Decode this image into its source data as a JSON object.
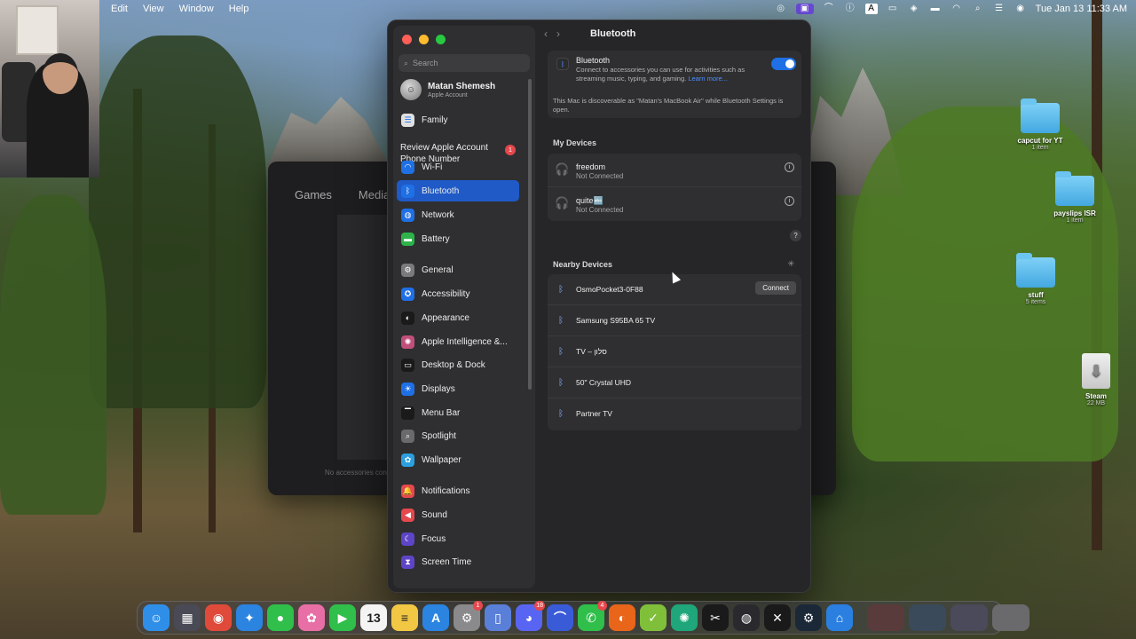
{
  "menubar": {
    "menus": [
      "Edit",
      "View",
      "Window",
      "Help"
    ],
    "datetime": "Tue Jan 13  11:33 AM",
    "status_icons": [
      "control-center-icon",
      "screen-record-icon",
      "bluetooth-status-icon",
      "a11y-icon",
      "input-a-icon",
      "display-icon",
      "vpn-icon",
      "battery-icon",
      "wifi-icon",
      "search-icon",
      "control-switch-icon",
      "siri-icon"
    ]
  },
  "background_window": {
    "tabs": [
      "Games",
      "Media"
    ],
    "footer": "No accessories conn"
  },
  "settings": {
    "search_placeholder": "Search",
    "account": {
      "name": "Matan Shemesh",
      "subtitle": "Apple Account"
    },
    "family": "Family",
    "review": {
      "label": "Review Apple Account Phone Number",
      "badge": "1"
    },
    "sidebar_items": [
      {
        "label": "Wi-Fi",
        "icon": "wifi-icon",
        "color": "#1f6fe5"
      },
      {
        "label": "Bluetooth",
        "icon": "bluetooth-icon",
        "color": "#1f6fe5",
        "selected": true
      },
      {
        "label": "Network",
        "icon": "globe-icon",
        "color": "#1f6fe5"
      },
      {
        "label": "Battery",
        "icon": "battery-icon",
        "color": "#2db34a"
      },
      {
        "label": "General",
        "icon": "gear-icon",
        "color": "#7a7a7c"
      },
      {
        "label": "Accessibility",
        "icon": "accessibility-icon",
        "color": "#1f6fe5"
      },
      {
        "label": "Appearance",
        "icon": "appearance-icon",
        "color": "#1a1a1a"
      },
      {
        "label": "Apple Intelligence &...",
        "icon": "apple-intelligence-icon",
        "color": "#c0507a"
      },
      {
        "label": "Desktop & Dock",
        "icon": "dock-icon",
        "color": "#1a1a1a"
      },
      {
        "label": "Displays",
        "icon": "sun-icon",
        "color": "#1f6fe5"
      },
      {
        "label": "Menu Bar",
        "icon": "menubar-icon",
        "color": "#1a1a1a"
      },
      {
        "label": "Spotlight",
        "icon": "magnifier-icon",
        "color": "#6a6a6c"
      },
      {
        "label": "Wallpaper",
        "icon": "flower-icon",
        "color": "#2b9fe0"
      },
      {
        "label": "Notifications",
        "icon": "bell-icon",
        "color": "#e5484d"
      },
      {
        "label": "Sound",
        "icon": "speaker-icon",
        "color": "#e5484d"
      },
      {
        "label": "Focus",
        "icon": "moon-icon",
        "color": "#5e45c7"
      },
      {
        "label": "Screen Time",
        "icon": "hourglass-icon",
        "color": "#5e45c7"
      }
    ],
    "content": {
      "title": "Bluetooth",
      "bluetooth_label": "Bluetooth",
      "bluetooth_desc": "Connect to accessories you can use for activities such as streaming music, typing, and gaming.",
      "learn_more": "Learn more...",
      "bluetooth_on": true,
      "discoverable": "This Mac is discoverable as \"Matan's MacBook Air\" while Bluetooth Settings is open.",
      "my_devices_title": "My Devices",
      "my_devices": [
        {
          "name": "freedom",
          "status": "Not Connected"
        },
        {
          "name": "quite🔤",
          "status": "Not Connected"
        }
      ],
      "help": "?",
      "nearby_title": "Nearby Devices",
      "nearby": [
        {
          "name": "OsmoPocket3-0F88",
          "action": "Connect"
        },
        {
          "name": "Samsung S95BA 65 TV"
        },
        {
          "name": "TV – סלון"
        },
        {
          "name": "50\" Crystal UHD"
        },
        {
          "name": "Partner TV"
        }
      ]
    }
  },
  "desktop_icons": [
    {
      "name": "capcut for YT",
      "sub": "1 item",
      "type": "folder"
    },
    {
      "name": "payslips ISR",
      "sub": "1 item",
      "type": "folder"
    },
    {
      "name": "stuff",
      "sub": "5 items",
      "type": "folder"
    },
    {
      "name": "Steam",
      "sub": "22 MB",
      "type": "disk"
    }
  ],
  "dock": {
    "apps": [
      {
        "name": "finder-icon",
        "glyph": "☺",
        "color": "#2f8fe8"
      },
      {
        "name": "launchpad-icon",
        "glyph": "▦",
        "color": "#4a4a56"
      },
      {
        "name": "chrome-icon",
        "glyph": "◉",
        "color": "#e04a3a"
      },
      {
        "name": "safari-icon",
        "glyph": "✦",
        "color": "#2a84e0"
      },
      {
        "name": "messages-icon",
        "glyph": "●",
        "color": "#2fbf4a"
      },
      {
        "name": "photos-icon",
        "glyph": "✿",
        "color": "#e86fa6"
      },
      {
        "name": "facetime-icon",
        "glyph": "▶",
        "color": "#2fbf4a"
      },
      {
        "name": "calendar-icon",
        "glyph": "13",
        "color": "#f4f4f4"
      },
      {
        "name": "notes-icon",
        "glyph": "≡",
        "color": "#f2c744"
      },
      {
        "name": "app-store-icon",
        "glyph": "A",
        "color": "#2a84e0"
      },
      {
        "name": "system-settings-icon",
        "glyph": "⚙",
        "color": "#8a8a8c",
        "badge": "1"
      },
      {
        "name": "files-icon",
        "glyph": "▯",
        "color": "#5a7fd8"
      },
      {
        "name": "discord-icon",
        "glyph": "◕",
        "color": "#5865f2",
        "badge": "18"
      },
      {
        "name": "arc-icon",
        "glyph": "⌒",
        "color": "#3a5bd8"
      },
      {
        "name": "whatsapp-icon",
        "glyph": "✆",
        "color": "#2fbf4a",
        "badge": "4"
      },
      {
        "name": "firefox-icon",
        "glyph": "◐",
        "color": "#e8651a"
      },
      {
        "name": "vine-icon",
        "glyph": "✓",
        "color": "#7fbf3a"
      },
      {
        "name": "chatgpt-icon",
        "glyph": "✺",
        "color": "#1fa67a"
      },
      {
        "name": "capcut-icon",
        "glyph": "✂",
        "color": "#1a1a1a"
      },
      {
        "name": "obs-icon",
        "glyph": "◍",
        "color": "#2a2a2e"
      },
      {
        "name": "cursor-app-icon",
        "glyph": "✕",
        "color": "#1a1a1a"
      },
      {
        "name": "steam-icon",
        "glyph": "⚙",
        "color": "#1b2838"
      },
      {
        "name": "xcode-icon",
        "glyph": "⌂",
        "color": "#2a7fe0"
      }
    ],
    "recent": [
      {
        "name": "recent-window-1-icon",
        "color": "#5a3b3b"
      },
      {
        "name": "recent-window-2-icon",
        "color": "#3b4a5a"
      },
      {
        "name": "recent-window-3-icon",
        "color": "#4a4a5a"
      },
      {
        "name": "trash-icon",
        "color": "#6a6a6c"
      }
    ]
  }
}
